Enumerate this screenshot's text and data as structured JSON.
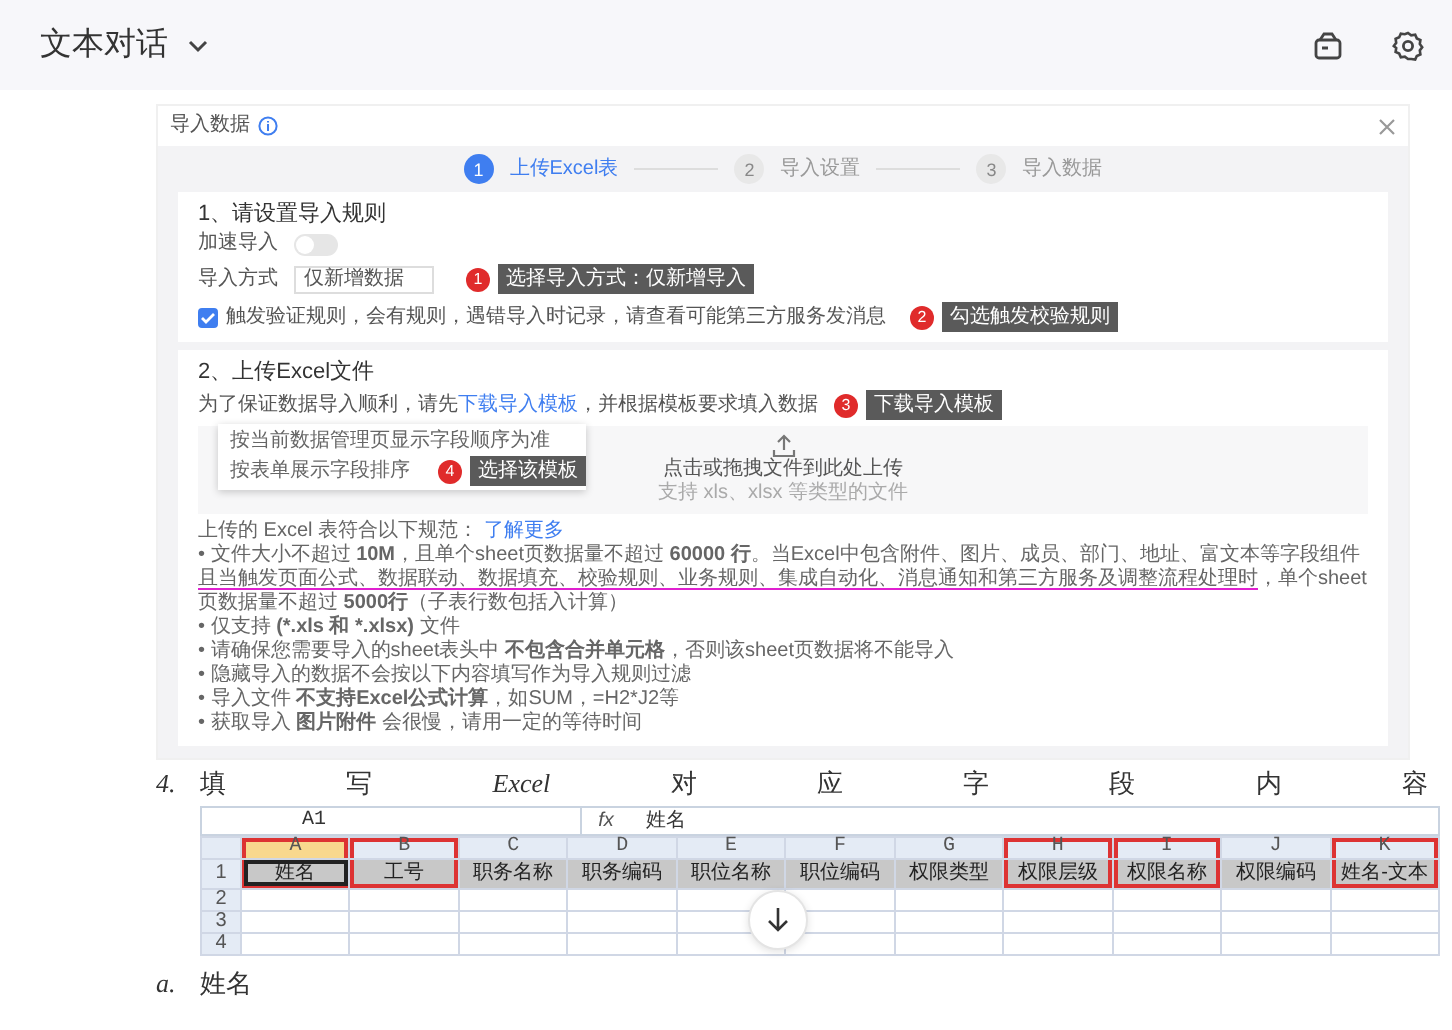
{
  "header": {
    "title": "文本对话"
  },
  "dialog": {
    "title": "导入数据",
    "steps": [
      {
        "number": "1",
        "label": "上传Excel表",
        "selected": true
      },
      {
        "number": "2",
        "label": "导入设置",
        "selected": false
      },
      {
        "number": "3",
        "label": "导入数据",
        "selected": false
      }
    ],
    "rules_section": {
      "title": "1、请设置导入规则",
      "speed_import": {
        "label": "加速导入",
        "on": false
      },
      "import_mode": {
        "label": "导入方式",
        "value": "仅新增数据",
        "callout": {
          "number": "1",
          "text": "选择导入方式：仅新增导入"
        }
      },
      "validation": {
        "label": "触发验证规则，会有规则，遇错导入时记录，请查看可能第三方服务发消息",
        "checked": true,
        "callout": {
          "number": "2",
          "text": "勾选触发校验规则"
        }
      }
    },
    "upload_section": {
      "title": "2、上传Excel文件",
      "instruction_before": "为了保证数据导入顺利，请先",
      "template_link": "下载导入模板",
      "instruction_after": "，并根据模板要求填入数据",
      "template_callout": {
        "number": "3",
        "text": "下载导入模板"
      },
      "template_menu": [
        {
          "label": "按当前数据管理页显示字段顺序为准"
        },
        {
          "label": "按表单展示字段排序",
          "callout": {
            "number": "4",
            "text": "选择该模板"
          }
        }
      ],
      "drop_title": "点击或拖拽文件到此处上传",
      "drop_hint": "支持 xls、xlsx 等类型的文件",
      "rules_intro": "上传的 Excel 表符合以下规范：",
      "learn_more": "了解更多",
      "rules": [
        [
          {
            "text": "• 文件大小不超过 **10M**，且单个sheet页数据量不超过 **60000 行**。当Excel中包含附件、图片、成员、部门、地址、富文本等字段组件",
            "marked": false
          },
          {
            "text": "且当触发页面公式、数据联动、数据填充、校验规则、业务规则、集成自动化、消息通知和第三方服务及调整流程处理时",
            "marked": true
          },
          {
            "text": "，单个sheet页数据量不超过 **5000行**（子表行数包括入计算）",
            "marked": false
          }
        ],
        [
          {
            "text": "• 仅支持 **(*.xls 和 *.xlsx)** 文件",
            "marked": false
          }
        ],
        [
          {
            "text": "• 请确保您需要导入的sheet表头中 **不包含合并单元格**，否则该sheet页数据将不能导入",
            "marked": false
          }
        ],
        [
          {
            "text": "• 隐藏导入的数据不会按以下内容填写作为导入规则过滤",
            "marked": false
          }
        ],
        [
          {
            "text": "• 导入文件 **不支持Excel公式计算**，如SUM，=H2*J2等",
            "marked": false
          }
        ],
        [
          {
            "text": "• 获取导入 **图片附件** 会很慢，请用一定的等待时间",
            "marked": false
          }
        ]
      ]
    }
  },
  "step_heading": {
    "number": "4.",
    "text_parts": [
      {
        "text": "填写",
        "italic": false
      },
      {
        "text": "Excel",
        "italic": true
      },
      {
        "text": "对应字段内容",
        "italic": false
      }
    ]
  },
  "sheet": {
    "name_box": "A1",
    "formula_label": "fx",
    "formula": "姓名",
    "columns": [
      {
        "letter": "A",
        "header": "姓名",
        "outlined": true,
        "selected": true
      },
      {
        "letter": "B",
        "header": "工号",
        "outlined": true,
        "selected": false
      },
      {
        "letter": "C",
        "header": "职务名称",
        "outlined": false,
        "selected": false
      },
      {
        "letter": "D",
        "header": "职务编码",
        "outlined": false,
        "selected": false
      },
      {
        "letter": "E",
        "header": "职位名称",
        "outlined": false,
        "selected": false
      },
      {
        "letter": "F",
        "header": "职位编码",
        "outlined": false,
        "selected": false
      },
      {
        "letter": "G",
        "header": "权限类型",
        "outlined": false,
        "selected": false
      },
      {
        "letter": "H",
        "header": "权限层级",
        "outlined": true,
        "selected": false
      },
      {
        "letter": "I",
        "header": "权限名称",
        "outlined": true,
        "selected": false
      },
      {
        "letter": "J",
        "header": "权限编码",
        "outlined": false,
        "selected": false
      },
      {
        "letter": "K",
        "header": "姓名-文本",
        "outlined": true,
        "selected": false
      }
    ],
    "rows": [
      "1",
      "2",
      "3",
      "4"
    ]
  },
  "sub_item": {
    "number": "a.",
    "text": "姓名"
  }
}
